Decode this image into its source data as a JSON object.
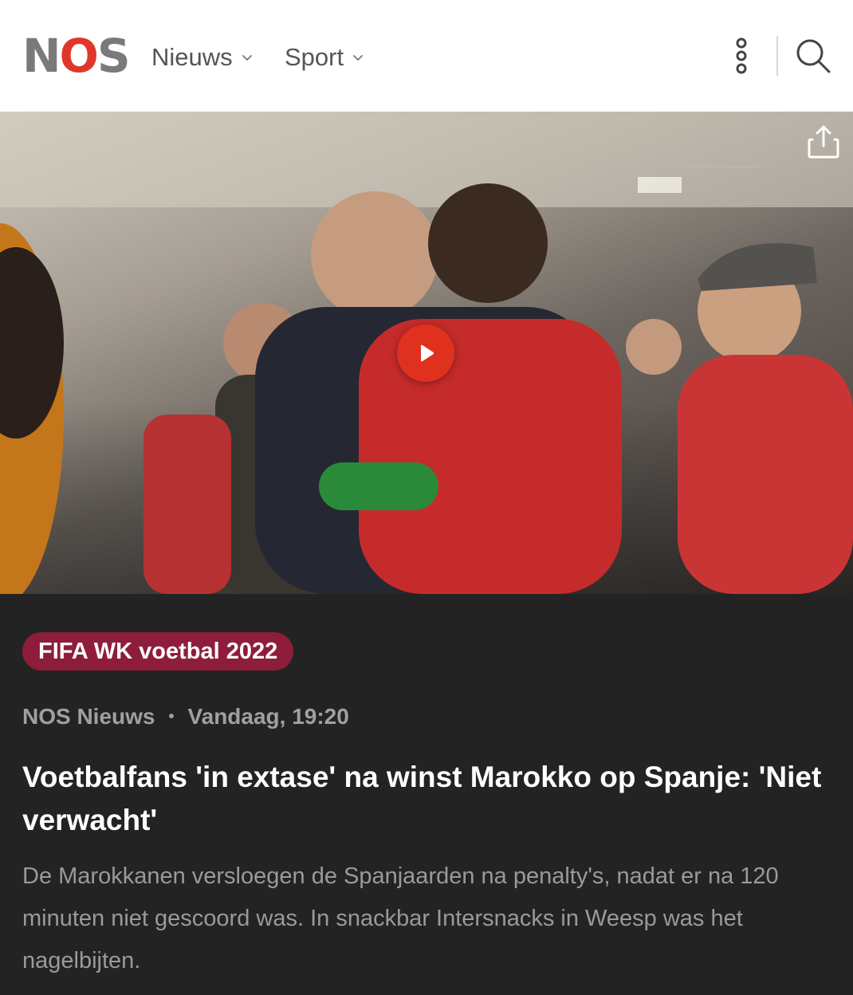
{
  "header": {
    "logo": {
      "n": "N",
      "o": "O",
      "s": "S"
    },
    "nav": [
      {
        "label": "Nieuws"
      },
      {
        "label": "Sport"
      }
    ],
    "icons": [
      "more-vertical-icon",
      "search-icon"
    ]
  },
  "media": {
    "type": "video",
    "icons": [
      "share-icon",
      "play-icon"
    ],
    "colors": {
      "play": "#e0311f"
    }
  },
  "article": {
    "tag": "FIFA WK voetbal 2022",
    "source": "NOS Nieuws",
    "separator": "•",
    "time": "Vandaag, 19:20",
    "title": "Voetbalfans 'in extase' na winst Marokko op Spanje: 'Niet verwacht'",
    "lead": "De Marokkanen versloegen de Spanjaarden na penalty's, nadat er na 120 minuten niet gescoord was. In snackbar Intersnacks in Weesp was het nagelbijten."
  },
  "colors": {
    "brand_red": "#e1372b",
    "logo_grey": "#7a7a7a",
    "tag_bg": "#8e1d3c",
    "content_bg": "#232323"
  }
}
